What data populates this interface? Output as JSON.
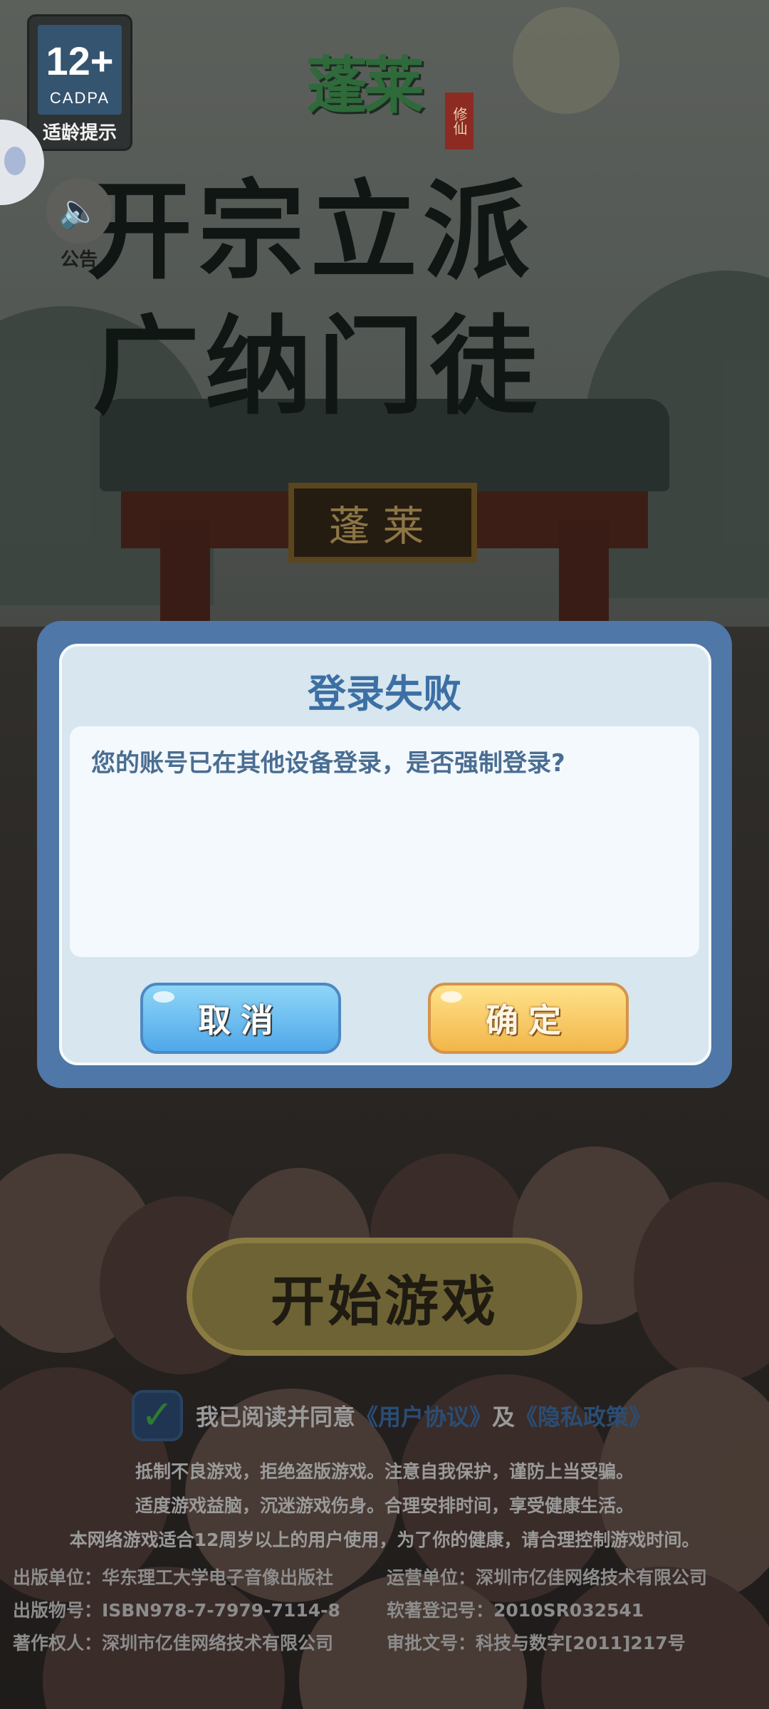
{
  "age_rating": {
    "number": "12+",
    "org": "CADPA",
    "tip": "适龄提示"
  },
  "notice": {
    "label": "公告"
  },
  "logo": {
    "title": "蓬莱",
    "seal": "修仙"
  },
  "slogan": {
    "line1": "开宗立派",
    "line2": "广纳门徒"
  },
  "gate_plaque": "蓬莱",
  "dialog": {
    "title": "登录失败",
    "message": "您的账号已在其他设备登录，是否强制登录?",
    "cancel_label": "取消",
    "confirm_label": "确定"
  },
  "start_button": "开始游戏",
  "agreement": {
    "prefix": "我已阅读并同意",
    "user_agreement": "《用户协议》",
    "and": "及",
    "privacy_policy": "《隐私政策》",
    "checked": true
  },
  "legal_lines": [
    "抵制不良游戏，拒绝盗版游戏。注意自我保护，谨防上当受骗。",
    "适度游戏益脑，沉迷游戏伤身。合理安排时间，享受健康生活。",
    "本网络游戏适合12周岁以上的用户使用，为了你的健康，请合理控制游戏时间。"
  ],
  "info": {
    "publisher": "出版单位：华东理工大学电子音像出版社",
    "operator": "运营单位：深圳市亿佳网络技术有限公司",
    "isbn": "出版物号：ISBN978-7-7979-7114-8",
    "software_reg": "软著登记号：2010SR032541",
    "copyright": "著作权人：深圳市亿佳网络技术有限公司",
    "approval": "审批文号：科技与数字[2011]217号"
  }
}
